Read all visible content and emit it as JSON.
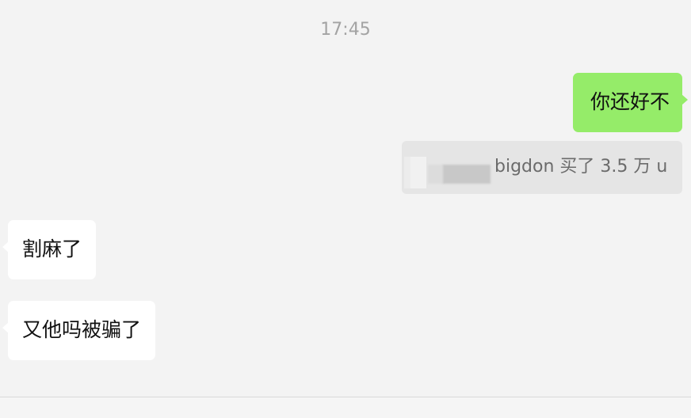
{
  "chat": {
    "timestamp": "17:45",
    "messages": [
      {
        "sender": "me",
        "text": "你还好不"
      },
      {
        "sender": "other",
        "text": "割麻了"
      },
      {
        "sender": "other",
        "text": "又他吗被骗了"
      }
    ],
    "quote": {
      "text": "bigdon 买了 3.5 万 u"
    }
  },
  "colors": {
    "background": "#f3f3f3",
    "outgoing_bubble": "#95ec69",
    "incoming_bubble": "#ffffff",
    "quote_background": "#e5e5e5",
    "timestamp_text": "#a3a3a3"
  }
}
